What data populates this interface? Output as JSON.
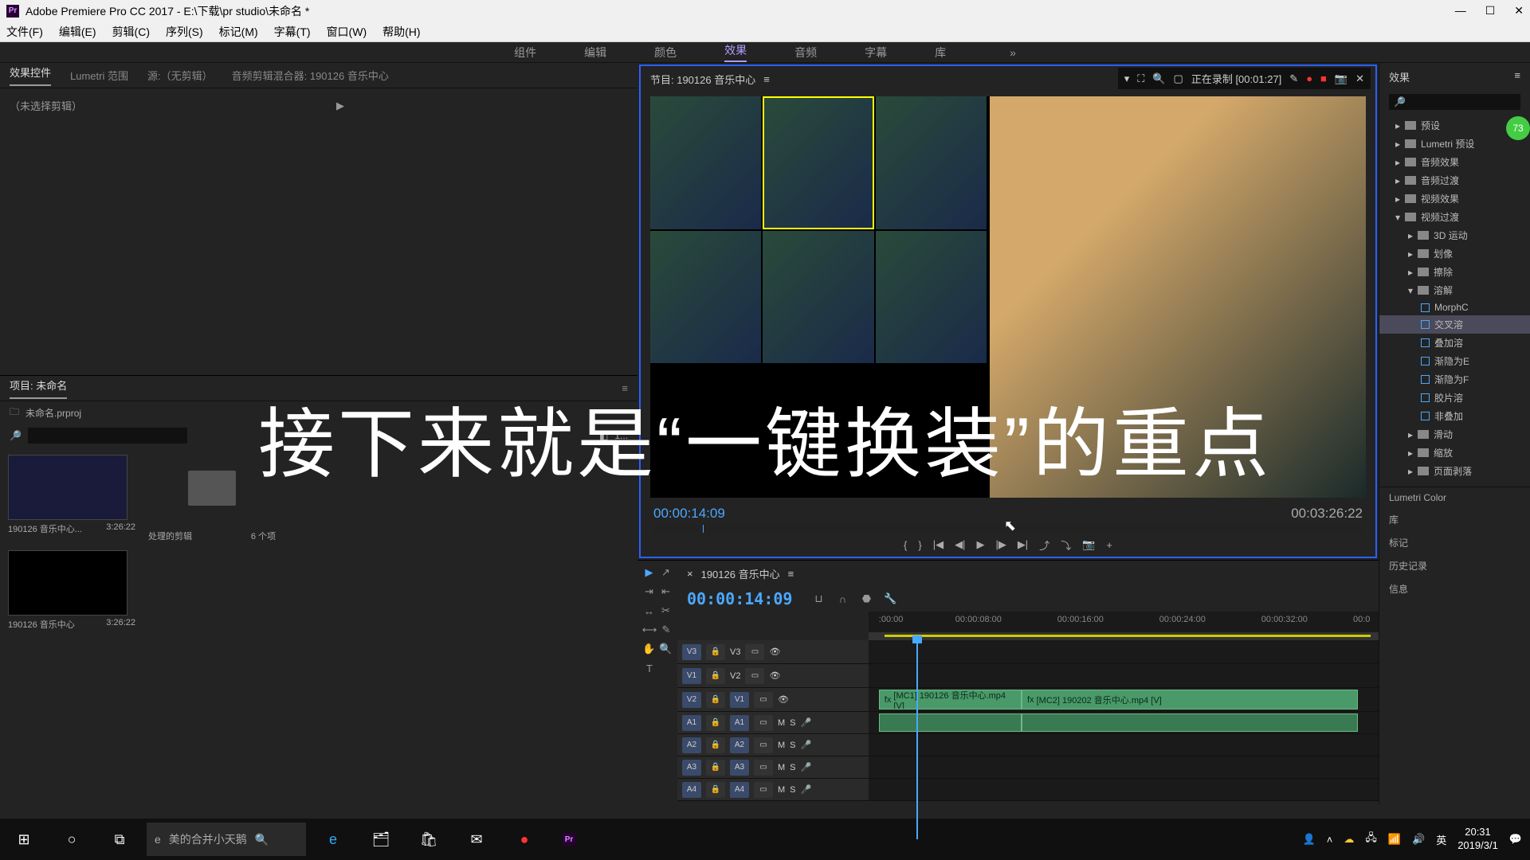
{
  "title": "Adobe Premiere Pro CC 2017 - E:\\下载\\pr studio\\未命名 *",
  "menus": [
    "文件(F)",
    "编辑(E)",
    "剪辑(C)",
    "序列(S)",
    "标记(M)",
    "字幕(T)",
    "窗口(W)",
    "帮助(H)"
  ],
  "workspaces": [
    "组件",
    "编辑",
    "颜色",
    "效果",
    "音频",
    "字幕",
    "库"
  ],
  "workspace_active": "效果",
  "ec_tabs": [
    "效果控件",
    "Lumetri 范围",
    "源:（无剪辑）",
    "音频剪辑混合器: 190126 音乐中心"
  ],
  "ec_noclip": "（未选择剪辑）",
  "program_title": "节目: 190126 音乐中心",
  "rec_label": "正在录制 [00:01:27]",
  "prog_tc_left": "00:00:14:09",
  "prog_tc_right": "00:03:26:22",
  "src_tc": "00:00:14:09",
  "project_tab": "项目: 未命名",
  "project_file": "未命名.prproj",
  "project_count": "1...",
  "bins": [
    {
      "name": "190126 音乐中心...",
      "dur": "3:26:22"
    },
    {
      "name": "处理的剪辑",
      "dur": "6 个项"
    },
    {
      "name": "190126 音乐中心",
      "dur": "3:26:22"
    }
  ],
  "seq_name": "190126 音乐中心",
  "seq_tc": "00:00:14:09",
  "ruler": [
    ":00:00",
    "00:00:08:00",
    "00:00:16:00",
    "00:00:24:00",
    "00:00:32:00",
    "00:0"
  ],
  "tracks_v": [
    "V3",
    "V1",
    "V2"
  ],
  "tracks_v_src": [
    "V3",
    "V2",
    "V1"
  ],
  "tracks_a": [
    "A1",
    "A2",
    "A3",
    "A4"
  ],
  "clip1": "[MC1] 190126 音乐中心.mp4 [V]",
  "clip2": "[MC2] 190202 音乐中心.mp4 [V]",
  "fx_title": "效果",
  "fx_tree": [
    {
      "l": 1,
      "t": "预设",
      "f": true
    },
    {
      "l": 1,
      "t": "Lumetri 预设",
      "f": true
    },
    {
      "l": 1,
      "t": "音频效果",
      "f": true
    },
    {
      "l": 1,
      "t": "音频过渡",
      "f": true
    },
    {
      "l": 1,
      "t": "视频效果",
      "f": true
    },
    {
      "l": 1,
      "t": "视频过渡",
      "f": true,
      "open": true
    },
    {
      "l": 2,
      "t": "3D 运动",
      "f": true
    },
    {
      "l": 2,
      "t": "划像",
      "f": true
    },
    {
      "l": 2,
      "t": "擦除",
      "f": true
    },
    {
      "l": 2,
      "t": "溶解",
      "f": true,
      "open": true
    },
    {
      "l": 3,
      "t": "MorphC",
      "p": true
    },
    {
      "l": 3,
      "t": "交叉溶",
      "p": true,
      "sel": true
    },
    {
      "l": 3,
      "t": "叠加溶",
      "p": true
    },
    {
      "l": 3,
      "t": "渐隐为E",
      "p": true
    },
    {
      "l": 3,
      "t": "渐隐为F",
      "p": true
    },
    {
      "l": 3,
      "t": "胶片溶",
      "p": true
    },
    {
      "l": 3,
      "t": "非叠加",
      "p": true
    },
    {
      "l": 2,
      "t": "滑动",
      "f": true
    },
    {
      "l": 2,
      "t": "缩放",
      "f": true
    },
    {
      "l": 2,
      "t": "页面剥落",
      "f": true
    }
  ],
  "fx_lower": [
    "Lumetri Color",
    "库",
    "标记",
    "历史记录",
    "信息"
  ],
  "overlay": "接下来就是“一键换装”的重点",
  "badge": "73",
  "tb_search": "美的合并小天鹅",
  "tb_ime": "英",
  "tb_time": "20:31",
  "tb_date": "2019/3/1"
}
